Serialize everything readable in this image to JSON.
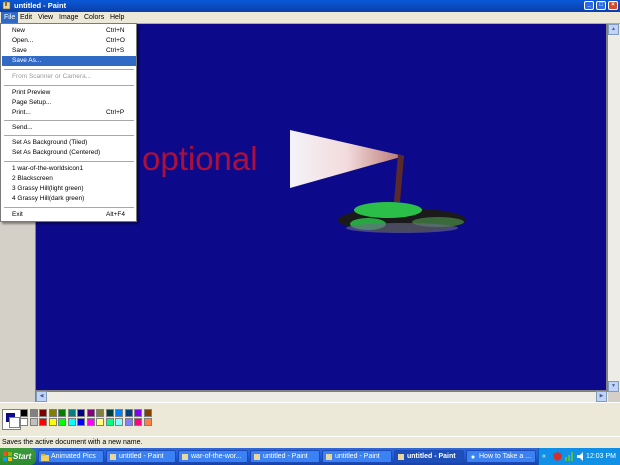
{
  "window": {
    "title": "untitled - Paint",
    "controls": {
      "minimize": "_",
      "maximize": "□",
      "close": "×"
    }
  },
  "menubar": [
    "File",
    "Edit",
    "View",
    "Image",
    "Colors",
    "Help"
  ],
  "file_menu": {
    "new": {
      "label": "New",
      "shortcut": "Ctrl+N"
    },
    "open": {
      "label": "Open...",
      "shortcut": "Ctrl+O"
    },
    "save": {
      "label": "Save",
      "shortcut": "Ctrl+S"
    },
    "save_as": {
      "label": "Save As..."
    },
    "from_scanner": {
      "label": "From Scanner or Camera..."
    },
    "print_preview": {
      "label": "Print Preview"
    },
    "page_setup": {
      "label": "Page Setup..."
    },
    "print": {
      "label": "Print...",
      "shortcut": "Ctrl+P"
    },
    "send": {
      "label": "Send..."
    },
    "bg_tiled": {
      "label": "Set As Background (Tiled)"
    },
    "bg_centered": {
      "label": "Set As Background (Centered)"
    },
    "recent": [
      "1 war-of-the-worldsicon1",
      "2 Blackscreen",
      "3 Grassy Hill(light green)",
      "4 Grassy Hill(dark green)"
    ],
    "exit": {
      "label": "Exit",
      "shortcut": "Alt+F4"
    }
  },
  "canvas": {
    "background_color": "#0c0a8a",
    "overlay_text": "optional"
  },
  "palette_colors": [
    "#000000",
    "#808080",
    "#800000",
    "#808000",
    "#008000",
    "#008080",
    "#000080",
    "#800080",
    "#808040",
    "#004040",
    "#0080ff",
    "#004080",
    "#8000ff",
    "#804000",
    "#ffffff",
    "#c0c0c0",
    "#ff0000",
    "#ffff00",
    "#00ff00",
    "#00ffff",
    "#0000ff",
    "#ff00ff",
    "#ffff80",
    "#00ff80",
    "#80ffff",
    "#8080ff",
    "#ff0080",
    "#ff8040"
  ],
  "status_text": "Saves the active document with a new name.",
  "taskbar": {
    "start_label": "Start",
    "tasks": [
      "Animated Pics",
      "untitled - Paint",
      "war-of-the-wor...",
      "untitled - Paint",
      "untitled - Paint",
      "untitled - Paint",
      "How to Take a ..."
    ],
    "active_task_index": 5,
    "clock": "12:03 PM"
  }
}
